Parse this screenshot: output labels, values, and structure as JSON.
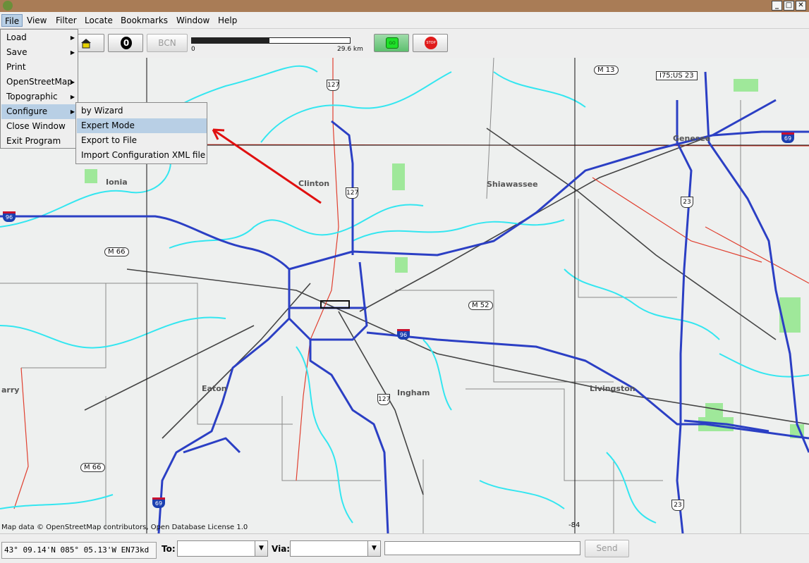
{
  "window": {
    "min": "_",
    "max": "□",
    "close": "✕"
  },
  "menubar": [
    "File",
    "View",
    "Filter",
    "Locate",
    "Bookmarks",
    "Window",
    "Help"
  ],
  "toolbar": {
    "bcn_label": "BCN",
    "zero_label": "0",
    "go_label": "GO",
    "stop_label": "STOP",
    "scale_start": "0",
    "scale_end": "29.6 km",
    "scale_fill_fraction": 0.49
  },
  "file_menu": [
    "Load",
    "Save",
    "Print",
    "OpenStreetMap",
    "Topographic",
    "Configure",
    "Close Window",
    "Exit Program"
  ],
  "configure_menu": [
    "by Wizard",
    "Expert Mode",
    "Export to File",
    "Import Configuration XML file"
  ],
  "map": {
    "places": [
      "Clinton",
      "Shiawassee",
      "Ionia",
      "Genesee",
      "Eaton",
      "Ingham",
      "Livingston",
      "arry"
    ],
    "shields": [
      "M 13",
      "I75;US 23",
      "M 66",
      "M 52",
      "M 66"
    ],
    "us_shields": [
      "127",
      "127",
      "23",
      "127",
      "23"
    ],
    "i_shields": [
      "69",
      "96",
      "96",
      "69"
    ],
    "credit": "Map data © OpenStreetMap contributors, Open Database License 1.0",
    "lon_label": "-84"
  },
  "status": {
    "coordinates": "43° 09.14'N 085° 05.13'W EN73kd",
    "to_label": "To:",
    "via_label": "Via:",
    "send_label": "Send"
  },
  "colors": {
    "accent": "#b8cfe5",
    "highway": "#2b3fc4",
    "water": "#33e6f0",
    "arrow": "#e01010"
  }
}
